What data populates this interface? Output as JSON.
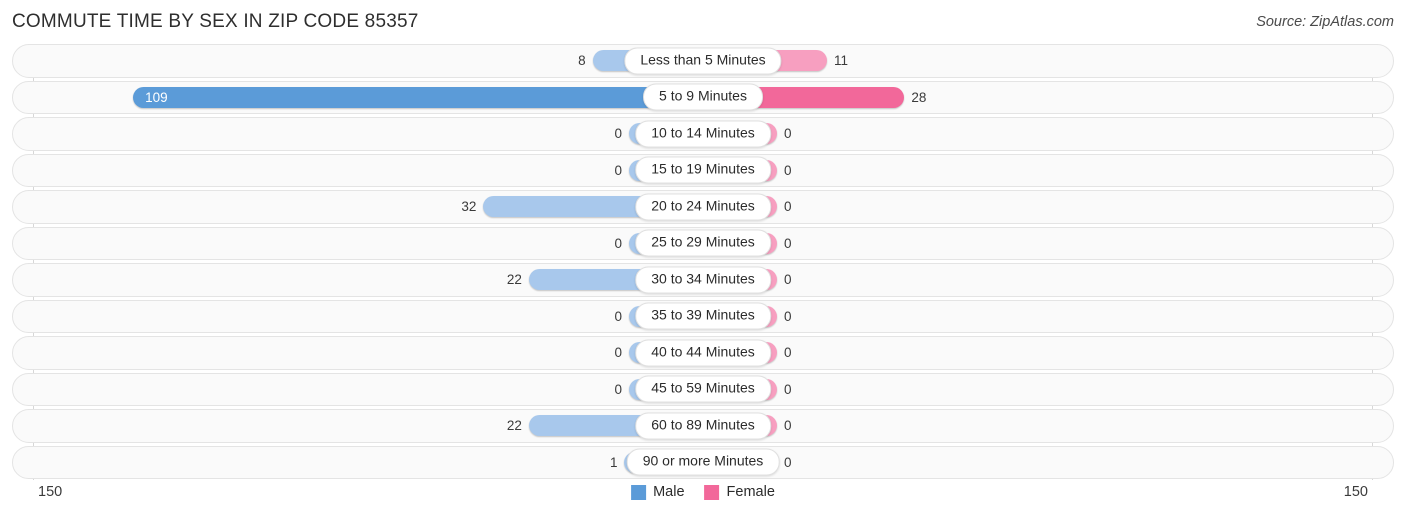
{
  "header": {
    "title": "COMMUTE TIME BY SEX IN ZIP CODE 85357",
    "source": "Source: ZipAtlas.com"
  },
  "axis": {
    "left_label": "150",
    "right_label": "150"
  },
  "legend": [
    {
      "label": "Male",
      "color": "#5b9bd8"
    },
    {
      "label": "Female",
      "color": "#f2689a"
    }
  ],
  "colors": {
    "male_strong": "#5b9bd8",
    "male_light": "#a8c8ec",
    "female_strong": "#f2689a",
    "female_light": "#f79fc0",
    "track": "#fafafa",
    "track_border": "#e4e4e4"
  },
  "chart_data": {
    "type": "bar",
    "title": "COMMUTE TIME BY SEX IN ZIP CODE 85357",
    "subtitle": "",
    "xlabel": "",
    "ylabel": "",
    "orientation": "horizontal",
    "style": "diverging-bidirectional",
    "axis_max": 150,
    "grid": false,
    "legend_position": "bottom-center",
    "categories": [
      "Less than 5 Minutes",
      "5 to 9 Minutes",
      "10 to 14 Minutes",
      "15 to 19 Minutes",
      "20 to 24 Minutes",
      "25 to 29 Minutes",
      "30 to 34 Minutes",
      "35 to 39 Minutes",
      "40 to 44 Minutes",
      "45 to 59 Minutes",
      "60 to 89 Minutes",
      "90 or more Minutes"
    ],
    "series": [
      {
        "name": "Male",
        "color": "#5b9bd8",
        "values": [
          8,
          109,
          0,
          0,
          32,
          0,
          22,
          0,
          0,
          0,
          22,
          1
        ]
      },
      {
        "name": "Female",
        "color": "#f2689a",
        "values": [
          11,
          28,
          0,
          0,
          0,
          0,
          0,
          0,
          0,
          0,
          0,
          0
        ]
      }
    ]
  },
  "rows": [
    {
      "category": "Less than 5 Minutes",
      "male": "8",
      "female": "11"
    },
    {
      "category": "5 to 9 Minutes",
      "male": "109",
      "female": "28"
    },
    {
      "category": "10 to 14 Minutes",
      "male": "0",
      "female": "0"
    },
    {
      "category": "15 to 19 Minutes",
      "male": "0",
      "female": "0"
    },
    {
      "category": "20 to 24 Minutes",
      "male": "32",
      "female": "0"
    },
    {
      "category": "25 to 29 Minutes",
      "male": "0",
      "female": "0"
    },
    {
      "category": "30 to 34 Minutes",
      "male": "22",
      "female": "0"
    },
    {
      "category": "35 to 39 Minutes",
      "male": "0",
      "female": "0"
    },
    {
      "category": "40 to 44 Minutes",
      "male": "0",
      "female": "0"
    },
    {
      "category": "45 to 59 Minutes",
      "male": "0",
      "female": "0"
    },
    {
      "category": "60 to 89 Minutes",
      "male": "22",
      "female": "0"
    },
    {
      "category": "90 or more Minutes",
      "male": "1",
      "female": "0"
    }
  ]
}
